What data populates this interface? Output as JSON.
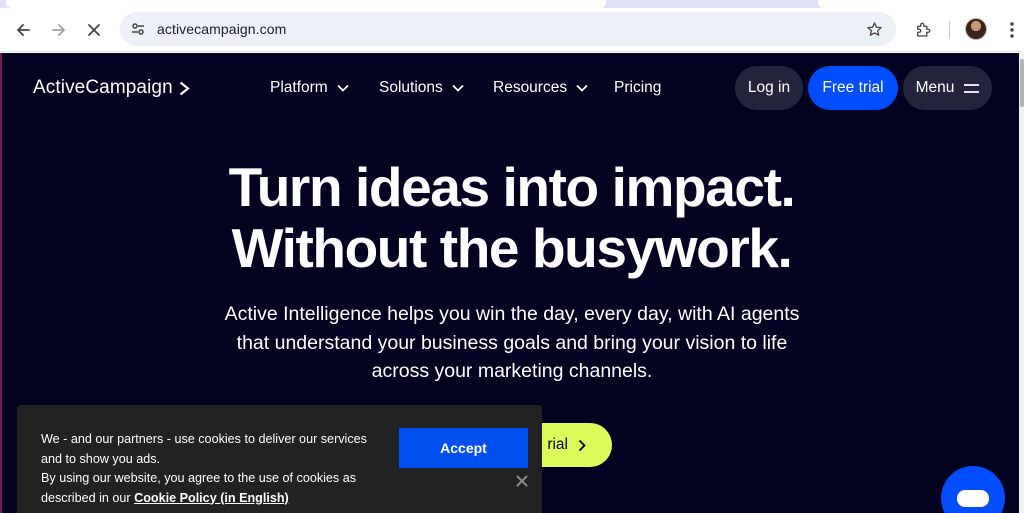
{
  "browser": {
    "url": "activecampaign.com",
    "icons": {
      "back": "arrow-left-icon",
      "forward": "arrow-right-icon",
      "stop": "close-x-icon",
      "site_info": "tune-icon",
      "bookmark": "star-icon",
      "extensions": "puzzle-icon",
      "profile": "avatar",
      "menu": "kebab-icon"
    }
  },
  "header": {
    "logo_text": "ActiveCampaign",
    "nav": [
      {
        "label": "Platform",
        "has_dropdown": true
      },
      {
        "label": "Solutions",
        "has_dropdown": true
      },
      {
        "label": "Resources",
        "has_dropdown": true
      },
      {
        "label": "Pricing",
        "has_dropdown": false
      }
    ],
    "login_label": "Log in",
    "free_trial_label": "Free trial",
    "menu_label": "Menu"
  },
  "hero": {
    "headline_line1": "Turn ideas into impact.",
    "headline_line2": "Without the busywork.",
    "subtitle_line1": "Active Intelligence helps you win the day, every day, with AI agents",
    "subtitle_line2": "that understand your business goals and bring your vision to life",
    "subtitle_line3": "across your marketing channels.",
    "cta_visible_label": "rial"
  },
  "cookie_banner": {
    "line1": "We - and our partners - use cookies to deliver our services",
    "line2": "and to show you ads.",
    "line3": "By using our website, you agree to the use of cookies as",
    "line4_prefix": "described in our ",
    "policy_link": "Cookie Policy (in English)",
    "accept_label": "Accept"
  },
  "colors": {
    "hero_bg": "#040221",
    "primary_blue": "#004cff",
    "cta_lime": "#dbfb5a",
    "pill_dark": "#24243e",
    "cookie_bg": "#222222"
  }
}
